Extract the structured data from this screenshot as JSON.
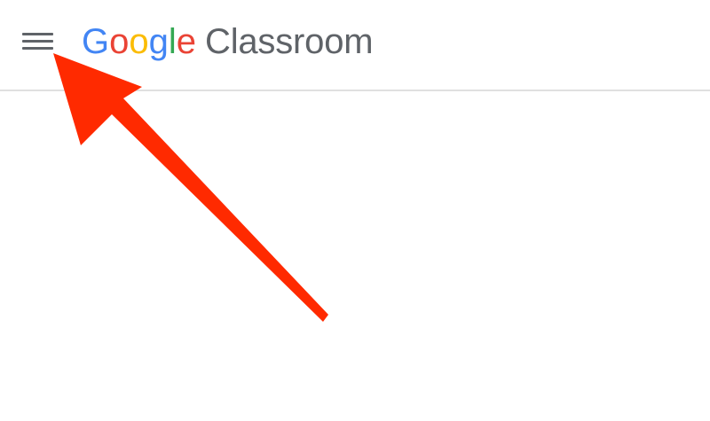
{
  "header": {
    "menu_icon": "hamburger-menu-icon",
    "brand": {
      "letters": [
        {
          "char": "G",
          "color": "#4285F4"
        },
        {
          "char": "o",
          "color": "#EA4335"
        },
        {
          "char": "o",
          "color": "#FBBC05"
        },
        {
          "char": "g",
          "color": "#4285F4"
        },
        {
          "char": "l",
          "color": "#34A853"
        },
        {
          "char": "e",
          "color": "#EA4335"
        }
      ],
      "product": "Classroom"
    }
  },
  "annotation": {
    "type": "arrow",
    "color": "#FF2A00"
  }
}
